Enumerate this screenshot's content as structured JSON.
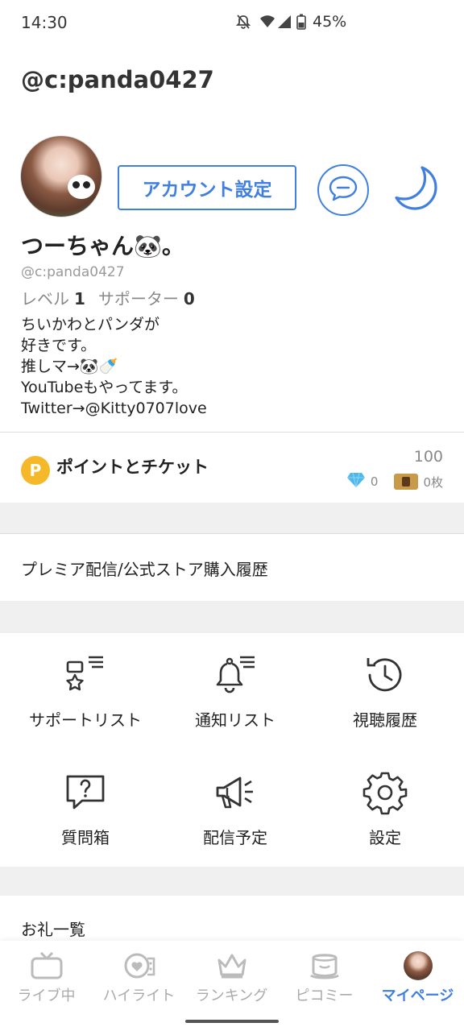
{
  "status_bar": {
    "time": "14:30",
    "battery": "45%"
  },
  "header": {
    "title": "@c:panda0427"
  },
  "profile": {
    "account_settings_label": "アカウント設定",
    "display_name": "つーちゃん🐼。",
    "handle": "@c:panda0427",
    "level_label": "レベル",
    "level_value": "1",
    "supporter_label": "サポーター",
    "supporter_value": "0",
    "bio": "ちいかわとパンダが\n好きです。\n推しマ→🐼🍼\nYouTubeもやってます。\nTwitter→@Kitty0707love"
  },
  "points": {
    "icon_letter": "P",
    "label": "ポイントとチケット",
    "value": "100",
    "gems": "0",
    "tickets": "0枚"
  },
  "premium": {
    "label": "プレミア配信/公式ストア購入履歴"
  },
  "grid": [
    {
      "label": "サポートリスト",
      "icon": "support-list-icon"
    },
    {
      "label": "通知リスト",
      "icon": "notification-list-icon"
    },
    {
      "label": "視聴履歴",
      "icon": "history-icon"
    },
    {
      "label": "質問箱",
      "icon": "question-box-icon"
    },
    {
      "label": "配信予定",
      "icon": "megaphone-icon"
    },
    {
      "label": "設定",
      "icon": "gear-icon"
    }
  ],
  "thanks": {
    "label": "お礼一覧"
  },
  "bottom_nav": [
    {
      "label": "ライブ中",
      "icon": "tv-icon"
    },
    {
      "label": "ハイライト",
      "icon": "highlight-icon"
    },
    {
      "label": "ランキング",
      "icon": "crown-icon"
    },
    {
      "label": "ピコミー",
      "icon": "picomy-icon"
    },
    {
      "label": "マイページ",
      "icon": "avatar"
    }
  ],
  "colors": {
    "accent": "#3f7fe0",
    "point": "#f5b829",
    "band": "#f0f0f0"
  }
}
